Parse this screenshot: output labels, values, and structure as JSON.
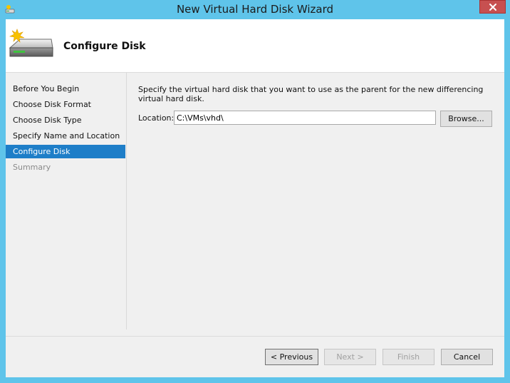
{
  "window": {
    "title": "New Virtual Hard Disk Wizard"
  },
  "header": {
    "title": "Configure Disk",
    "icon": "hard-disk-icon"
  },
  "nav": {
    "items": [
      {
        "label": "Before You Begin",
        "state": "normal"
      },
      {
        "label": "Choose Disk Format",
        "state": "normal"
      },
      {
        "label": "Choose Disk Type",
        "state": "normal"
      },
      {
        "label": "Specify Name and Location",
        "state": "normal"
      },
      {
        "label": "Configure Disk",
        "state": "active"
      },
      {
        "label": "Summary",
        "state": "disabled"
      }
    ]
  },
  "content": {
    "description": "Specify the virtual hard disk that you want to use as the parent for the new differencing virtual hard disk.",
    "location_label": "Location:",
    "location_value": "C:\\VMs\\vhd\\",
    "browse_label": "Browse..."
  },
  "footer": {
    "previous_label": "< Previous",
    "next_label": "Next >",
    "finish_label": "Finish",
    "cancel_label": "Cancel"
  },
  "colors": {
    "title_bar": "#5fc4ea",
    "selection": "#1e7ec8",
    "close": "#c75050"
  }
}
